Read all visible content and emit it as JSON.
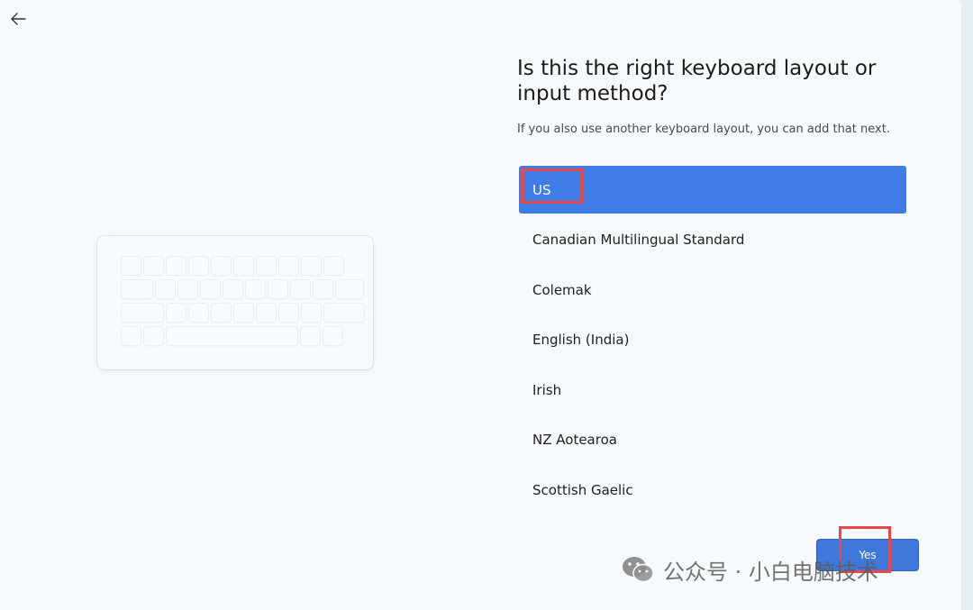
{
  "title": "Is this the right keyboard layout or input method?",
  "subtitle": "If you also use another keyboard layout, you can add that next.",
  "layouts": [
    {
      "label": "US",
      "selected": true
    },
    {
      "label": "Canadian Multilingual Standard",
      "selected": false
    },
    {
      "label": "Colemak",
      "selected": false
    },
    {
      "label": "English (India)",
      "selected": false
    },
    {
      "label": "Irish",
      "selected": false
    },
    {
      "label": "NZ Aotearoa",
      "selected": false
    },
    {
      "label": "Scottish Gaelic",
      "selected": false
    }
  ],
  "buttons": {
    "yes_label": "Yes"
  },
  "icons": {
    "back": "back-arrow-icon",
    "keyboard": "keyboard-illustration",
    "watermark": "wechat-icon"
  },
  "watermark": {
    "text": "公众号 · 小白电脑技术"
  },
  "colors": {
    "accent": "#407ce6",
    "annotation": "#e8484a"
  }
}
